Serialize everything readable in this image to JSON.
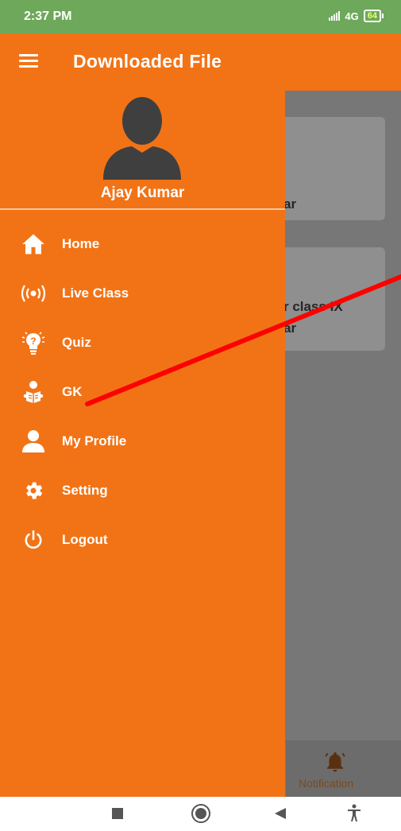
{
  "status_bar": {
    "time": "2:37 PM",
    "network": "4G",
    "battery": "64"
  },
  "app_bar": {
    "title": "Downloaded File"
  },
  "drawer": {
    "user_name": "Ajay Kumar",
    "items": [
      {
        "label": "Home",
        "icon": "home-icon"
      },
      {
        "label": "Live Class",
        "icon": "live-broadcast-icon"
      },
      {
        "label": "Quiz",
        "icon": "lightbulb-question-icon"
      },
      {
        "label": "GK",
        "icon": "reading-person-icon"
      },
      {
        "label": "My Profile",
        "icon": "person-icon"
      },
      {
        "label": "Setting",
        "icon": "gear-icon"
      },
      {
        "label": "Logout",
        "icon": "power-icon"
      }
    ]
  },
  "background": {
    "card1_text": "ar",
    "card2_line1": "r class IX",
    "card2_line2": "ar",
    "bottom_nav_label": "Notification"
  },
  "colors": {
    "primary": "#f27316",
    "status_bar": "#6ea85a",
    "scrim": "#777777",
    "annotation": "#ff0000"
  }
}
